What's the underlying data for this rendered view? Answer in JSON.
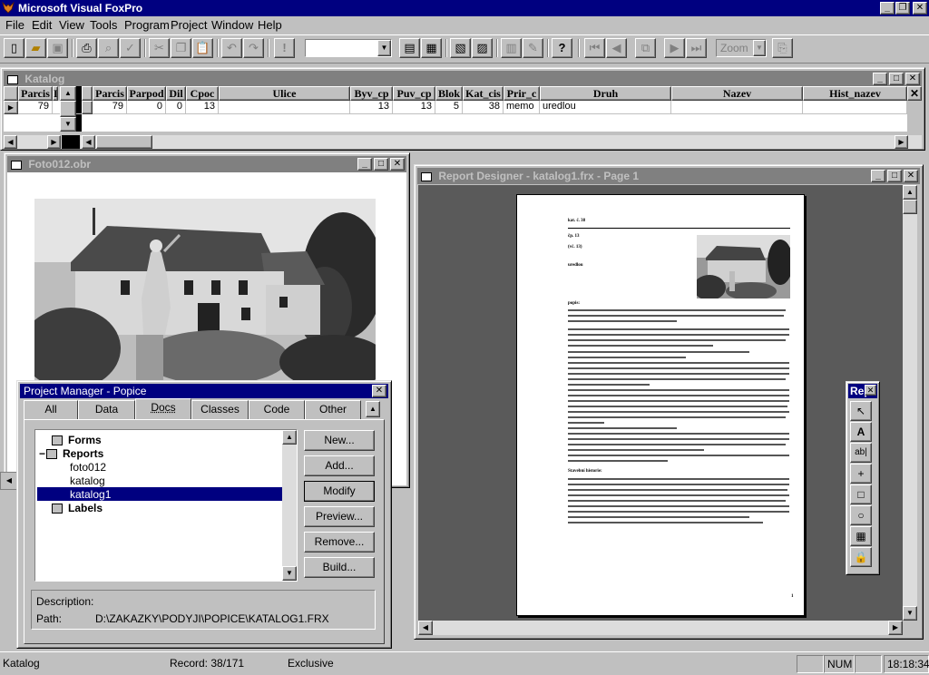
{
  "app": {
    "title": "Microsoft Visual FoxPro",
    "min": "_",
    "max": "❐",
    "close": "✕"
  },
  "menu": [
    "File",
    "Edit",
    "View",
    "Tools",
    "Program",
    "Project",
    "Window",
    "Help"
  ],
  "toolbar": {
    "zoom": "Zoom",
    "combo_value": ""
  },
  "catalog": {
    "title": "Katalog",
    "left_columns": [
      "Parcis",
      "I"
    ],
    "left_row": [
      "79",
      ""
    ],
    "columns": [
      "Parcis",
      "Parpod",
      "Dil",
      "Cpoc",
      "Ulice",
      "Byv_cp",
      "Puv_cp",
      "Blok",
      "Kat_cis",
      "Prir_c",
      "Druh",
      "Nazev",
      "Hist_nazev"
    ],
    "row": [
      "79",
      "0",
      "0",
      "13",
      "",
      "13",
      "13",
      "5",
      "38",
      "memo",
      "uredlou",
      "",
      ""
    ]
  },
  "photo": {
    "title": "Foto012.obr"
  },
  "report": {
    "title": "Report Designer - katalog1.frx - Page 1",
    "page_number": "1",
    "head_lines": [
      "kat. č. 38",
      "čp. 13",
      "(vč. 13)",
      "uredlou"
    ],
    "section1": "popis:",
    "section2": "Stavební historie:"
  },
  "report_controls": {
    "title": "Rep"
  },
  "project_manager": {
    "title": "Project Manager - Popice",
    "tabs": [
      "All",
      "Data",
      "Docs",
      "Classes",
      "Code",
      "Other"
    ],
    "active_tab": "Docs",
    "tree": [
      {
        "label": "Forms",
        "level": 0,
        "bold": true
      },
      {
        "label": "Reports",
        "level": 0,
        "bold": true
      },
      {
        "label": "foto012",
        "level": 1,
        "bold": false
      },
      {
        "label": "katalog",
        "level": 1,
        "bold": false
      },
      {
        "label": "katalog1",
        "level": 1,
        "bold": false,
        "selected": true
      },
      {
        "label": "Labels",
        "level": 0,
        "bold": true
      }
    ],
    "buttons": [
      "New...",
      "Add...",
      "Modify",
      "Preview...",
      "Remove...",
      "Build..."
    ],
    "description_label": "Description:",
    "path_label": "Path:",
    "path_value": "D:\\ZAKAZKY\\PODYJI\\POPICE\\KATALOG1.FRX"
  },
  "status": {
    "alias": "Katalog",
    "record": "Record: 38/171",
    "lock": "Exclusive",
    "num": "NUM",
    "time": "18:18:34"
  }
}
